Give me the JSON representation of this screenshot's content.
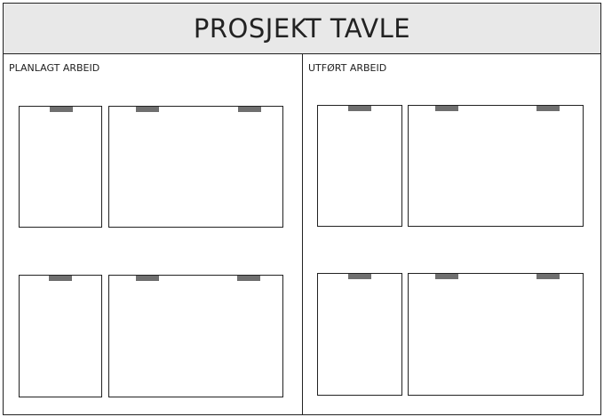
{
  "title": "PROSJEKT TAVLE",
  "columns": {
    "left": {
      "label": "PLANLAGT ARBEID"
    },
    "right": {
      "label": "UTFØRT ARBEID"
    }
  },
  "colors": {
    "title_bar_background": "#e8e8e8",
    "border": "#222222",
    "clip": "#6f6f6f"
  }
}
